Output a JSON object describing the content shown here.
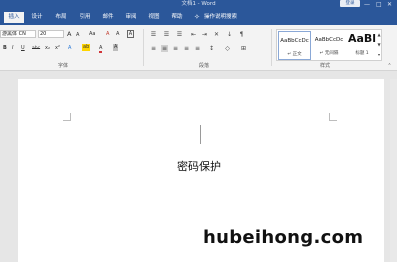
{
  "window": {
    "title": "文档1 - Word",
    "login_label": "登录",
    "minimize": "—",
    "maximize": "□",
    "close": "✕"
  },
  "menu": {
    "tabs": [
      "插入",
      "设计",
      "布局",
      "引用",
      "邮件",
      "审阅",
      "视图",
      "帮助"
    ],
    "active_index": 0,
    "tell_me": "操作说明搜索"
  },
  "ribbon": {
    "font": {
      "font_name": "游黑体 CN",
      "font_size": "20",
      "grow": "A",
      "shrink": "A",
      "case": "Aa",
      "clear": "A",
      "phonetic": "A",
      "bold": "B",
      "italic": "I",
      "underline": "U",
      "strike": "abc",
      "subscript": "x₂",
      "superscript": "x²",
      "text_effect": "A",
      "highlight": "ab",
      "font_color": "A",
      "shading": "A",
      "border": "A",
      "group_label": "字体"
    },
    "paragraph": {
      "group_label": "段落"
    },
    "styles": {
      "items": [
        {
          "sample": "AaBbCcDc",
          "name": "↵ 正文"
        },
        {
          "sample": "AaBbCcDc",
          "name": "↵ 无间隔"
        },
        {
          "sample": "AaBl",
          "name": "标题 1"
        }
      ],
      "group_label": "样式"
    }
  },
  "document": {
    "text": "密码保护",
    "watermark": "hubeihong.com"
  },
  "colors": {
    "brand": "#2b579a",
    "ribbon_bg": "#f3f3f3",
    "highlight_yellow": "#ffd500",
    "font_red": "#d13438"
  }
}
